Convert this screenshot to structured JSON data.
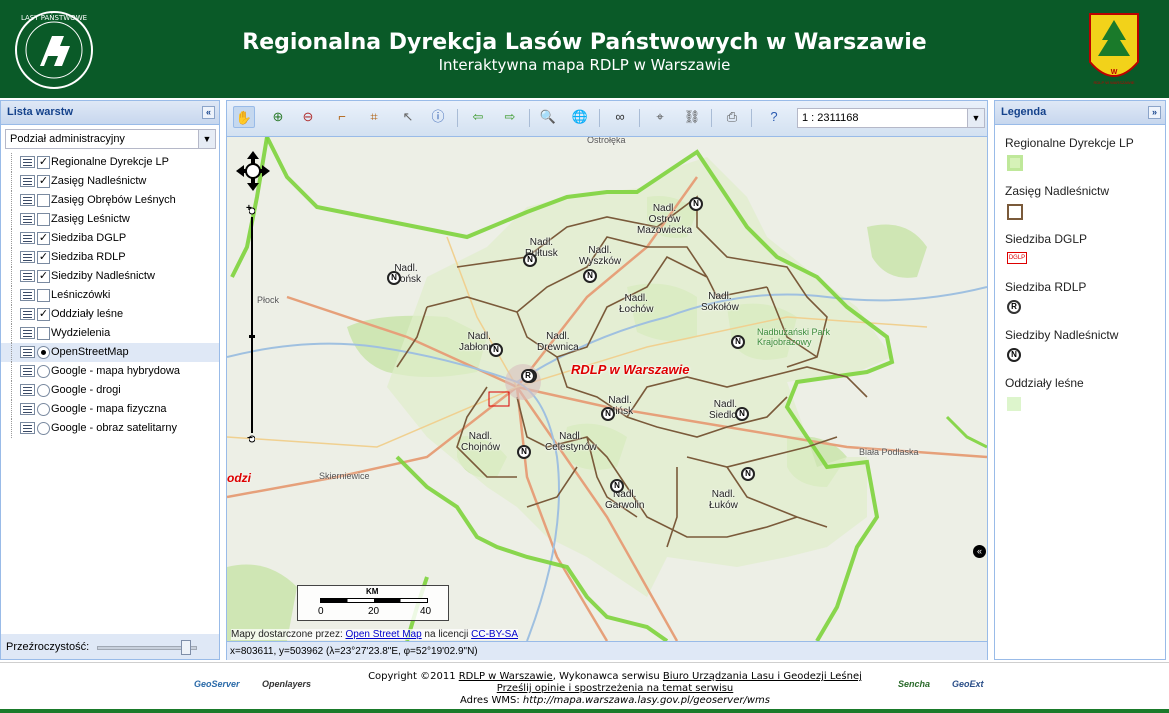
{
  "header": {
    "title": "Regionalna Dyrekcja Lasów Państwowych w Warszawie",
    "subtitle": "Interaktywna mapa RDLP w Warszawie",
    "logo_left_text": "LASY PAŃSTWOWE",
    "logo_right_text": "RDLP W WARSZAWIE",
    "brand_color": "#0a5a28"
  },
  "left_panel": {
    "title": "Lista warstw",
    "collapse_icon": "«",
    "group_select": "Podział administracyjny",
    "layers": [
      {
        "label": "Regionalne Dyrekcje LP",
        "type": "check",
        "checked": true
      },
      {
        "label": "Zasięg Nadleśnictw",
        "type": "check",
        "checked": true
      },
      {
        "label": "Zasięg Obrębów Leśnych",
        "type": "check",
        "checked": false
      },
      {
        "label": "Zasięg Leśnictw",
        "type": "check",
        "checked": false
      },
      {
        "label": "Siedziba DGLP",
        "type": "check",
        "checked": true
      },
      {
        "label": "Siedziba RDLP",
        "type": "check",
        "checked": true
      },
      {
        "label": "Siedziby Nadleśnictw",
        "type": "check",
        "checked": true
      },
      {
        "label": "Leśniczówki",
        "type": "check",
        "checked": false
      },
      {
        "label": "Oddziały leśne",
        "type": "check",
        "checked": true
      },
      {
        "label": "Wydzielenia",
        "type": "check",
        "checked": false
      },
      {
        "label": "OpenStreetMap",
        "type": "radio",
        "checked": true
      },
      {
        "label": "Google - mapa hybrydowa",
        "type": "radio",
        "checked": false
      },
      {
        "label": "Google - drogi",
        "type": "radio",
        "checked": false
      },
      {
        "label": "Google - mapa fizyczna",
        "type": "radio",
        "checked": false
      },
      {
        "label": "Google - obraz satelitarny",
        "type": "radio",
        "checked": false
      }
    ],
    "opacity_label": "Przeźroczystość:",
    "opacity_value": 0.92
  },
  "toolbar": {
    "scale": "1 : 2311168",
    "buttons": [
      "pan-icon",
      "zoom-in-icon",
      "zoom-out-icon",
      "measure-length-icon",
      "measure-area-icon",
      "select-icon",
      "info-icon",
      "back-icon",
      "forward-icon",
      "search-icon",
      "full-extent-icon",
      "binoculars-icon",
      "locate-icon",
      "link-icon",
      "print-icon",
      "help-icon"
    ]
  },
  "map": {
    "attribution_prefix": "Mapy dostarczone przez: ",
    "attribution_link": "Open Street Map",
    "attribution_mid": " na licencji ",
    "attribution_license": "CC-BY-SA",
    "coordinates": "x=803611, y=503962 (λ=23°27'23.8\"E, φ=52°19'02.9\"N)",
    "rdlp_label": "RDLP w Warszawie",
    "scale_unit": "KM",
    "scale_ticks": [
      "0",
      "20",
      "40"
    ],
    "nadlesnictwa": [
      {
        "name": "Nadl.\nOstrów\nMazowiecka"
      },
      {
        "name": "Nadl.\nPułtusk"
      },
      {
        "name": "Nadl.\nWyszków"
      },
      {
        "name": "Nadl.\nPłońsk"
      },
      {
        "name": "Nadl.\nŁochów"
      },
      {
        "name": "Nadl.\nSokołów"
      },
      {
        "name": "Nadl.\nJabłonna"
      },
      {
        "name": "Nadl.\nDrewnica"
      },
      {
        "name": "Nadl.\nMińsk"
      },
      {
        "name": "Nadl.\nSiedlce"
      },
      {
        "name": "Nadl.\nChojnów"
      },
      {
        "name": "Nadl.\nCelestynów"
      },
      {
        "name": "Nadl.\nGarwolin"
      },
      {
        "name": "Nadl.\nŁuków"
      }
    ],
    "towns": [
      "Ostrołęka",
      "Płock",
      "Skierniewice",
      "Biała Podlaska",
      "Nadbużański Park Krajobrazowy",
      "odzi"
    ],
    "accent_green": "#7dd33c",
    "accent_brown": "#7a5a3a"
  },
  "right_panel": {
    "title": "Legenda",
    "collapse_icon": "»",
    "items": [
      "Regionalne Dyrekcje LP",
      "Zasięg Nadleśnictw",
      "Siedziba DGLP",
      "Siedziba RDLP",
      "Siedziby Nadleśnictw",
      "Oddziały leśne"
    ],
    "dglp_symbol_text": "DGLP"
  },
  "footer": {
    "copyright_prefix": "Copyright ©2011 ",
    "rdlp_link": "RDLP w Warszawie",
    "contractor_prefix": ", Wykonawca serwisu ",
    "contractor_link": "Biuro Urządzania Lasu i Geodezji Leśnej",
    "feedback_link": "Prześlij opinie i spostrzeżenia na temat serwisu",
    "wms_prefix": "Adres WMS: ",
    "wms_url": "http://mapa.warszawa.lasy.gov.pl/geoserver/wms",
    "brands": [
      "GeoServer",
      "Openlayers",
      "Sencha",
      "GeoExt"
    ]
  }
}
